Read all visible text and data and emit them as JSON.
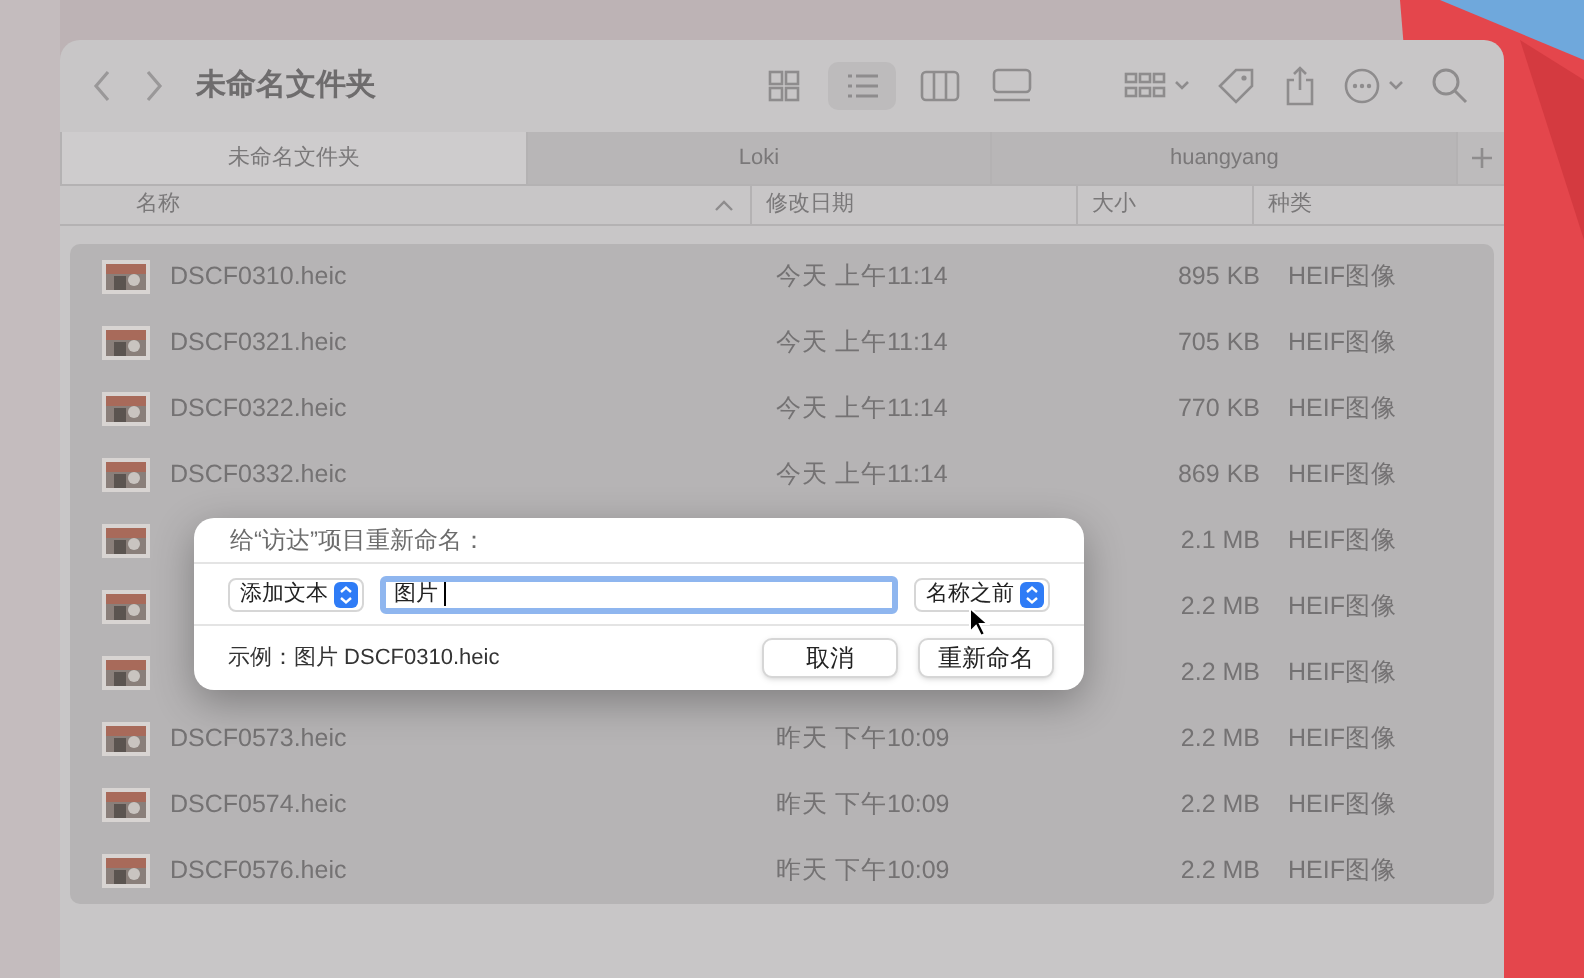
{
  "window": {
    "title": "未命名文件夹"
  },
  "tabs": [
    {
      "label": "未命名文件夹",
      "selected": true
    },
    {
      "label": "Loki",
      "selected": false
    },
    {
      "label": "huangyang",
      "selected": false
    }
  ],
  "columns": [
    "名称",
    "修改日期",
    "大小",
    "种类"
  ],
  "rows": [
    {
      "name": "DSCF0310.heic",
      "date": "今天 上午11:14",
      "size": "895 KB",
      "kind": "HEIF图像",
      "selected": true
    },
    {
      "name": "DSCF0321.heic",
      "date": "今天 上午11:14",
      "size": "705 KB",
      "kind": "HEIF图像",
      "selected": true
    },
    {
      "name": "DSCF0322.heic",
      "date": "今天 上午11:14",
      "size": "770 KB",
      "kind": "HEIF图像",
      "selected": true
    },
    {
      "name": "DSCF0332.heic",
      "date": "今天 上午11:14",
      "size": "869 KB",
      "kind": "HEIF图像",
      "selected": true
    },
    {
      "size": "2.1 MB",
      "kind": "HEIF图像",
      "selected": true
    },
    {
      "size": "2.2 MB",
      "kind": "HEIF图像",
      "selected": true
    },
    {
      "size": "2.2 MB",
      "kind": "HEIF图像",
      "selected": true
    },
    {
      "name": "DSCF0573.heic",
      "date": "昨天 下午10:09",
      "size": "2.2 MB",
      "kind": "HEIF图像",
      "selected": true
    },
    {
      "name": "DSCF0574.heic",
      "date": "昨天 下午10:09",
      "size": "2.2 MB",
      "kind": "HEIF图像",
      "selected": true
    },
    {
      "name": "DSCF0576.heic",
      "date": "昨天 下午10:09",
      "size": "2.2 MB",
      "kind": "HEIF图像",
      "selected": true
    }
  ],
  "dialog": {
    "title": "给“访达”项目重新命名：",
    "mode": "添加文本",
    "text": "图片",
    "position": "名称之前",
    "example": "示例：图片 DSCF0310.heic",
    "buttons": [
      "取消",
      "重新命名"
    ]
  }
}
